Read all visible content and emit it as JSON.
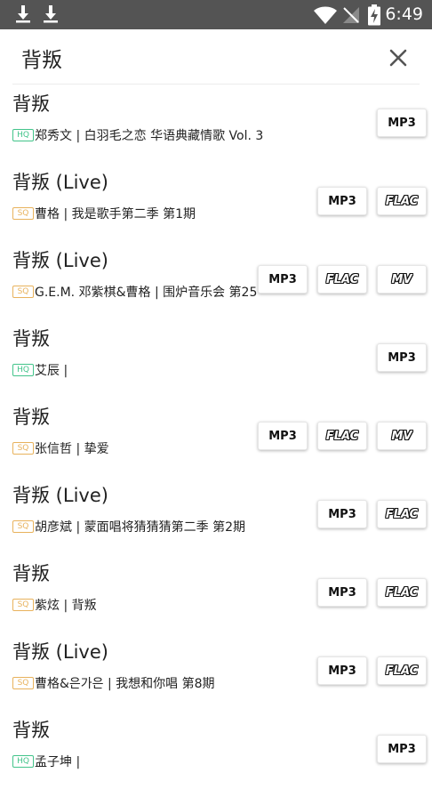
{
  "status_bar": {
    "time": "6:49",
    "icons": [
      "download-icon",
      "download-icon",
      "wifi-icon",
      "no-signal-icon",
      "battery-charging-icon"
    ]
  },
  "search": {
    "query": "背叛",
    "close_icon": "close-icon"
  },
  "colors": {
    "status_bar": "#545454",
    "hq_badge": "#42c48a",
    "sq_badge": "#e8b25c"
  },
  "results": [
    {
      "title": "背叛",
      "quality": "HQ",
      "subtitle": "郑秀文 | 白羽毛之恋 华语典藏情歌 Vol. 3",
      "buttons": [
        "MP3"
      ]
    },
    {
      "title": "背叛 (Live)",
      "quality": "SQ",
      "subtitle": "曹格 | 我是歌手第二季 第1期",
      "buttons": [
        "MP3",
        "FLAC"
      ]
    },
    {
      "title": "背叛 (Live)",
      "quality": "SQ",
      "subtitle": "G.E.M. 邓紫棋&曹格 | 围炉音乐会 第25",
      "buttons": [
        "MP3",
        "FLAC",
        "MV"
      ]
    },
    {
      "title": "背叛",
      "quality": "HQ",
      "subtitle": "艾辰 |",
      "buttons": [
        "MP3"
      ]
    },
    {
      "title": "背叛",
      "quality": "SQ",
      "subtitle": "张信哲 | 挚爱",
      "buttons": [
        "MP3",
        "FLAC",
        "MV"
      ]
    },
    {
      "title": "背叛 (Live)",
      "quality": "SQ",
      "subtitle": "胡彦斌 | 蒙面唱将猜猜猜第二季 第2期",
      "buttons": [
        "MP3",
        "FLAC"
      ]
    },
    {
      "title": "背叛",
      "quality": "SQ",
      "subtitle": "紫炫 | 背叛",
      "buttons": [
        "MP3",
        "FLAC"
      ]
    },
    {
      "title": "背叛 (Live)",
      "quality": "SQ",
      "subtitle": "曹格&은가은 | 我想和你唱 第8期",
      "buttons": [
        "MP3",
        "FLAC"
      ]
    },
    {
      "title": "背叛",
      "quality": "HQ",
      "subtitle": "孟子坤 |",
      "buttons": [
        "MP3"
      ]
    }
  ]
}
